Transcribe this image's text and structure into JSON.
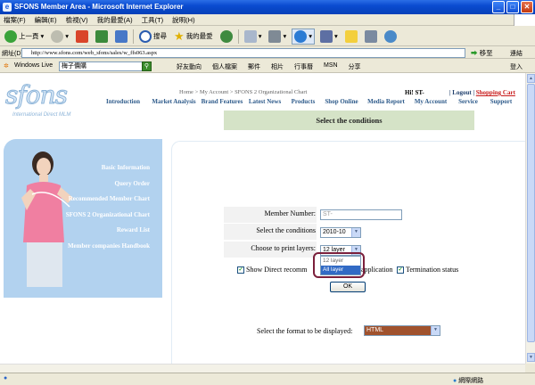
{
  "window": {
    "title": "SFONS Member Area - Microsoft Internet Explorer"
  },
  "menu": [
    "檔案(F)",
    "編輯(E)",
    "檢視(V)",
    "我的最愛(A)",
    "工具(T)",
    "說明(H)"
  ],
  "toolbar": {
    "back_label": "上一頁",
    "search_label": "搜尋",
    "favorites_label": "我的最愛"
  },
  "address": {
    "label": "網址(D)",
    "url": "http://www.sfons.com/web_sfons/sales/w_ffs063.aspx",
    "go_label": "移至",
    "links_label": "連結"
  },
  "linksbar": {
    "windows_live": "Windows Live",
    "search_value": "梅子價購",
    "items": [
      "好友動向",
      "個人檔案",
      "郵件",
      "相片",
      "行事曆",
      "MSN",
      "分享"
    ],
    "signin": "登入"
  },
  "site": {
    "logo_word": "sfons",
    "logo_tagline": "International Direct MLM",
    "nav": [
      "Introduction",
      "Market Analysis",
      "Brand Features",
      "Latest News",
      "Products",
      "Shop Online",
      "Media Report",
      "My Account",
      "Service",
      "Support"
    ]
  },
  "sidenav": [
    "Basic Information",
    "Query Order",
    "Recommended Member Chart",
    "SFONS 2 Organizational Chart",
    "Reward List",
    "Member companies Handbook"
  ],
  "breadcrumb": {
    "home": "Home",
    "account": "My Account",
    "current": "SFONS 2 Organizational Chart"
  },
  "header_links": {
    "greeting": "Hi! ST-",
    "logout": "Logout",
    "cart": "Shopping Cart"
  },
  "form": {
    "title": "Select the conditions",
    "member_label": "Member Number:",
    "member_value": "ST-",
    "cond_label": "Select the conditions",
    "cond_value": "2010-10",
    "layers_label": "Choose to print layers:",
    "layers_value": "12 layer",
    "dropdown_options": [
      "12 layer",
      "All layer"
    ],
    "chk1_label": "Show Direct recomm",
    "chk2_label": "application",
    "chk3_label": "Termination status",
    "ok_label": "OK",
    "format_label": "Select the format to be displayed:",
    "format_value": "HTML"
  },
  "status": {
    "zone": "網際網路"
  }
}
